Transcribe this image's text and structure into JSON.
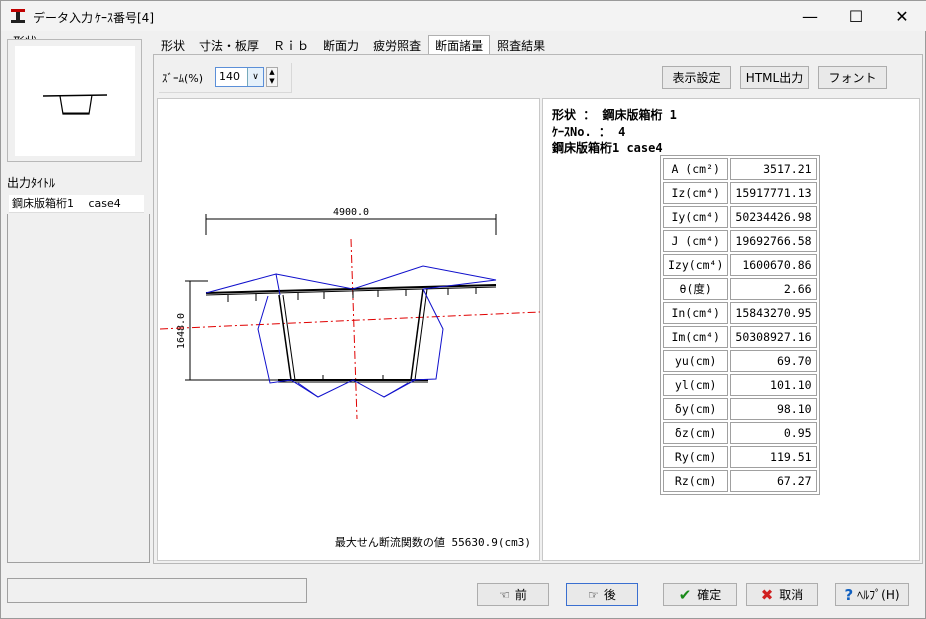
{
  "window": {
    "title": "データ入力",
    "case_label": "ｹｰｽ番号[4]",
    "minimize": "—",
    "maximize": "☐",
    "close": "✕"
  },
  "left": {
    "shape_label": "形状",
    "output_title_label": "出力ﾀｲﾄﾙ",
    "output_title_value": "鋼床版箱桁1　 case4"
  },
  "tabs": [
    {
      "label": "形状"
    },
    {
      "label": "寸法・板厚"
    },
    {
      "label": "Ｒｉｂ"
    },
    {
      "label": "断面力"
    },
    {
      "label": "疲労照査"
    },
    {
      "label": "断面諸量"
    },
    {
      "label": "照査結果"
    }
  ],
  "active_tab": "断面諸量",
  "toolbar": {
    "zoom_label": "ｽﾞｰﾑ(%)",
    "zoom_value": "140",
    "display_settings": "表示設定",
    "html_output": "HTML出力",
    "font": "フォント"
  },
  "drawing": {
    "width_dim": "4900.0",
    "height_dim": "1648.0",
    "max_shear_text": "最大せん断流関数の値 55630.9(cm3)"
  },
  "props": {
    "shape_line": "形状 ： 鋼床版箱桁 1",
    "case_line": "ｹｰｽNo. ： 4",
    "name_line": "鋼床版箱桁1 case4",
    "rows": [
      {
        "key": "A (cm²)",
        "value": "3517.21"
      },
      {
        "key": "Iz(cm⁴)",
        "value": "15917771.13"
      },
      {
        "key": "Iy(cm⁴)",
        "value": "50234426.98"
      },
      {
        "key": "J (cm⁴)",
        "value": "19692766.58"
      },
      {
        "key": "Izy(cm⁴)",
        "value": "1600670.86"
      },
      {
        "key": "θ(度)",
        "value": "2.66"
      },
      {
        "key": "In(cm⁴)",
        "value": "15843270.95"
      },
      {
        "key": "Im(cm⁴)",
        "value": "50308927.16"
      },
      {
        "key": "yu(cm)",
        "value": "69.70"
      },
      {
        "key": "yl(cm)",
        "value": "101.10"
      },
      {
        "key": "δy(cm)",
        "value": "98.10"
      },
      {
        "key": "δz(cm)",
        "value": "0.95"
      },
      {
        "key": "Ry(cm)",
        "value": "119.51"
      },
      {
        "key": "Rz(cm)",
        "value": "67.27"
      }
    ]
  },
  "buttons": {
    "prev": "前",
    "next": "後",
    "ok": "確定",
    "cancel": "取消",
    "help": "ﾍﾙﾌﾟ(H)"
  },
  "colors": {
    "blue_line": "#1010cc",
    "red_axis": "#e00000",
    "ok_check": "#1a8a1a",
    "cancel_x": "#d02020",
    "help_q": "#1060c0"
  }
}
